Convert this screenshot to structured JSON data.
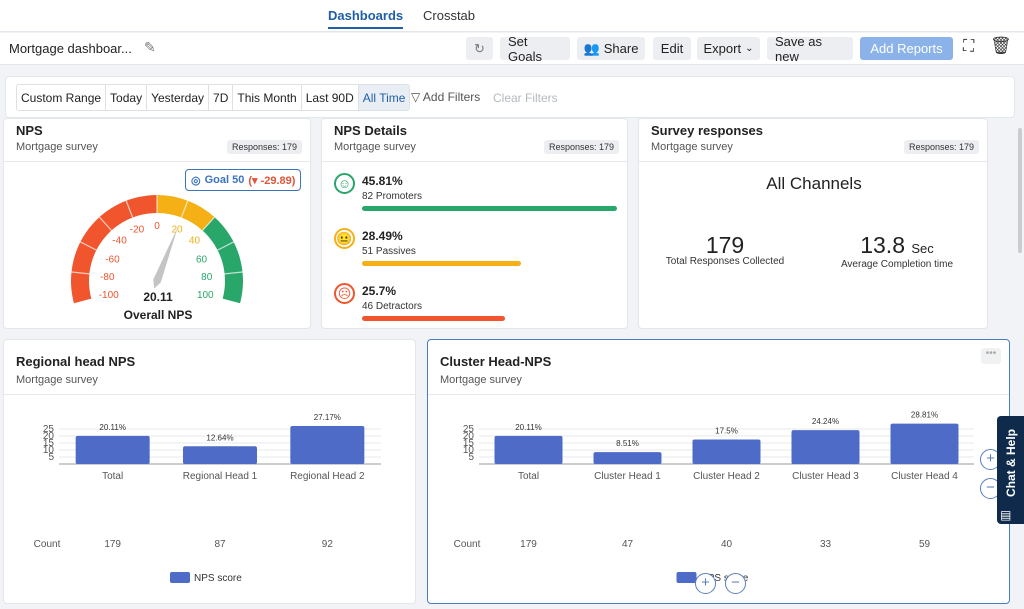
{
  "nav": {
    "tabs": [
      {
        "label": "Dashboards",
        "active": true
      },
      {
        "label": "Crosstab",
        "active": false
      }
    ]
  },
  "toolbar": {
    "title": "Mortgage dashboar...",
    "edit_icon": "pencil-icon",
    "refresh_icon": "refresh-icon",
    "set_goals": "Set Goals",
    "share": "Share",
    "edit": "Edit",
    "export": "Export",
    "save_as_new": "Save as new",
    "add_reports": "Add Reports",
    "fullscreen_icon": "expand-icon",
    "delete_icon": "trash-icon"
  },
  "filters": {
    "ranges": [
      "Custom Range",
      "Today",
      "Yesterday",
      "7D",
      "This Month",
      "Last 90D",
      "All Time"
    ],
    "selected": "All Time",
    "add_filters": "Add Filters",
    "clear_filters": "Clear Filters"
  },
  "nps_card": {
    "title": "NPS",
    "subtitle": "Mortgage survey",
    "responses": "Responses: 179",
    "goal": "Goal 50",
    "goal_delta": "(▾ -29.89)",
    "value": "20.11",
    "value_num": 20.11,
    "label": "Overall NPS",
    "ticks": [
      "-100",
      "-80",
      "-60",
      "-40",
      "-20",
      "0",
      "20",
      "40",
      "60",
      "80",
      "100"
    ],
    "colors": {
      "detractor": "#f0552e",
      "passive": "#f5b015",
      "promoter": "#29a66a"
    }
  },
  "nps_details": {
    "title": "NPS Details",
    "subtitle": "Mortgage survey",
    "responses": "Responses: 179",
    "rows": [
      {
        "pct": "45.81%",
        "label": "82 Promoters",
        "value": 45.81,
        "color": "#29a66a",
        "icon": "smile-icon"
      },
      {
        "pct": "28.49%",
        "label": "51 Passives",
        "value": 28.49,
        "color": "#f5b015",
        "icon": "neutral-face-icon"
      },
      {
        "pct": "25.7%",
        "label": "46 Detractors",
        "value": 25.7,
        "color": "#f0552e",
        "icon": "angry-face-icon"
      }
    ]
  },
  "survey": {
    "title": "Survey responses",
    "subtitle": "Mortgage survey",
    "responses": "Responses: 179",
    "channel": "All Channels",
    "total": "179",
    "total_label": "Total Responses Collected",
    "avg": "13.8",
    "avg_unit": "Sec",
    "avg_label": "Average Completion time"
  },
  "regional": {
    "title": "Regional head NPS",
    "subtitle": "Mortgage survey",
    "count_label": "Count",
    "counts": [
      "179",
      "87",
      "92"
    ],
    "legend": "NPS score"
  },
  "cluster": {
    "title": "Cluster Head-NPS",
    "subtitle": "Mortgage survey",
    "count_label": "Count",
    "counts": [
      "179",
      "47",
      "40",
      "33",
      "59"
    ],
    "legend": "NPS score",
    "menu_icon": "more-icon"
  },
  "chat": {
    "label": "Chat & Help"
  },
  "chart_data": [
    {
      "type": "bar",
      "categories": [
        "Total",
        "Regional Head 1",
        "Regional Head 2"
      ],
      "values": [
        20.11,
        12.64,
        27.17
      ],
      "data_labels": [
        "20.11%",
        "12.64%",
        "27.17%"
      ],
      "yticks": [
        "5",
        "10",
        "15",
        "20",
        "25"
      ],
      "ylim": [
        0,
        25
      ],
      "grid": true,
      "series": [
        {
          "name": "NPS score",
          "color": "#4f6bc8"
        }
      ],
      "legend": "bottom"
    },
    {
      "type": "bar",
      "categories": [
        "Total",
        "Cluster  Head 1",
        "Cluster  Head 2",
        "Cluster  Head 3",
        "Cluster  Head 4"
      ],
      "values": [
        20.11,
        8.51,
        17.5,
        24.24,
        28.81
      ],
      "data_labels": [
        "20.11%",
        "8.51%",
        "17.5%",
        "24.24%",
        "28.81%"
      ],
      "yticks": [
        "5",
        "10",
        "15",
        "20",
        "25"
      ],
      "ylim": [
        0,
        25
      ],
      "grid": true,
      "series": [
        {
          "name": "NPS score",
          "color": "#4f6bc8"
        }
      ],
      "legend": "bottom"
    }
  ]
}
